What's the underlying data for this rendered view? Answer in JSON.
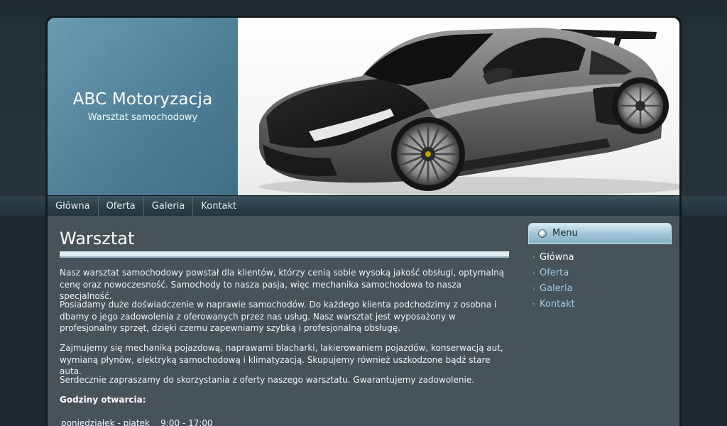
{
  "header": {
    "site_title": "ABC Motoryzacja",
    "site_subtitle": "Warsztat samochodowy",
    "photo": "sports-car-photo"
  },
  "nav": {
    "items": [
      {
        "label": "Główna"
      },
      {
        "label": "Oferta"
      },
      {
        "label": "Galeria"
      },
      {
        "label": "Kontakt"
      }
    ]
  },
  "main": {
    "title": "Warsztat",
    "paragraphs": [
      "Nasz warsztat samochodowy powstał dla klientów, którzy cenią sobie wysoką jakość obsługi, optymalną cenę oraz nowoczesność. Samochody to nasza pasja, więc mechanika samochodowa to nasza specjalność.",
      "Posiadamy duże doświadczenie w naprawie samochodów. Do każdego klienta podchodzimy z osobna i dbamy o jego zadowolenia z oferowanych przez nas usług. Nasz warsztat jest wyposażony w profesjonalny sprzęt, dzięki czemu zapewniamy szybką i profesjonalną obsługę.",
      "Zajmujemy się mechaniką pojazdową, naprawami blacharki, lakierowaniem pojazdów, konserwacją aut, wymianą płynów, elektryką samochodową i klimatyzacją. Skupujemy również uszkodzone bądź stare auta.",
      "Serdecznie zapraszamy do skorzystania z oferty naszego warsztatu. Gwarantujemy zadowolenie."
    ],
    "hours_heading": "Godziny otwarcia:",
    "hours_line": "poniedziałek - piątek    9:00 - 17:00"
  },
  "sidebar": {
    "title": "Menu",
    "items": [
      {
        "label": "Główna",
        "active": true
      },
      {
        "label": "Oferta",
        "active": false
      },
      {
        "label": "Galeria",
        "active": false
      },
      {
        "label": "Kontakt",
        "active": false
      }
    ]
  },
  "colors": {
    "header_blue": "#4d7f98",
    "content_bg": "#475359",
    "link": "#9fcce0"
  }
}
